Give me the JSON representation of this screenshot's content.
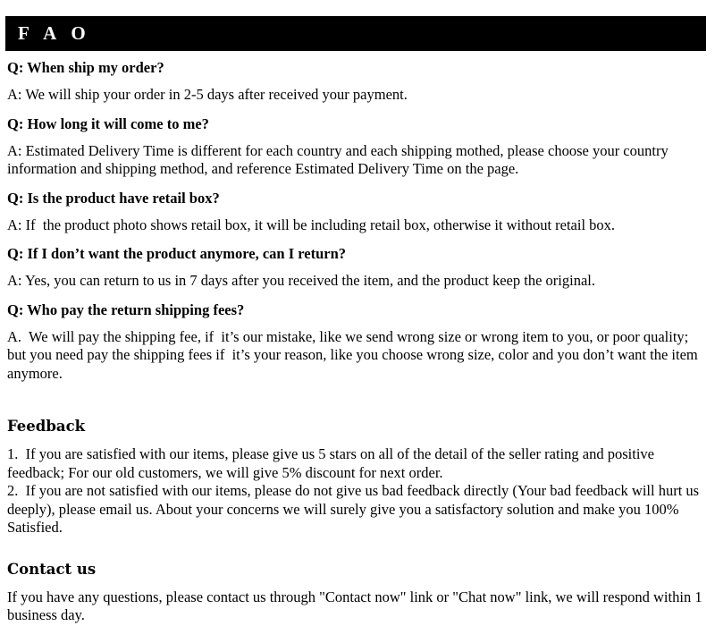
{
  "banner": {
    "title": "F A O",
    "background_color": "#000000",
    "text_color": "#ffffff"
  },
  "faq": {
    "items": [
      {
        "question": "Q: When ship my order?",
        "answer": "A: We will ship your order in 2-5 days after received your payment."
      },
      {
        "question": "Q: How long it will come to me?",
        "answer": "A: Estimated Delivery Time is different for each country and each shipping mothed, please choose your country information and shipping method, and reference Estimated Delivery Time on the page."
      },
      {
        "question": "Q: Is the product have retail box?",
        "answer": "A: If  the product photo shows retail box, it will be including retail box, otherwise it without retail box."
      },
      {
        "question": "Q: If I don’t want the product anymore, can I return?",
        "answer": "A: Yes, you can return to us in 7 days after you received the item, and the product keep the original."
      },
      {
        "question": "Q: Who pay the return shipping fees?",
        "answer": "A.  We will pay the shipping fee, if  it’s our mistake, like we send wrong size or wrong item to you, or poor quality; but you need pay the shipping fees if  it’s your reason, like you choose wrong size, color and you don’t want the item anymore."
      }
    ]
  },
  "feedback": {
    "heading": "Feedback",
    "body": "1.  If you are satisfied with our items, please give us 5 stars on all of the detail of the seller rating and positive feedback; For our old customers, we will give 5% discount for next order.\n2.  If you are not satisfied with our items, please do not give us bad feedback directly (Your bad feedback will hurt us deeply), please email us. About your concerns we will surely give you a satisfactory solution and make you 100% Satisfied."
  },
  "contact": {
    "heading": "Contact us",
    "body": "If you have any questions, please contact us through \"Contact now\" link or \"Chat now\" link, we will respond within 1 business day."
  }
}
